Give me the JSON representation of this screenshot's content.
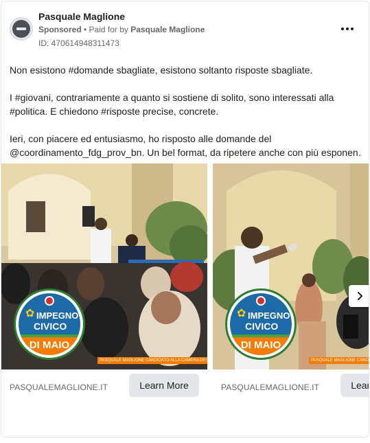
{
  "header": {
    "page_name": "Pasquale Maglione",
    "sponsored": "Sponsored",
    "separator": " • ",
    "paid_for_by": "Paid for by",
    "payer": "Pasquale Maglione",
    "ad_id": "ID: 470614948311473"
  },
  "body": {
    "paragraph_1": "Non esistono #domande sbagliate, esistono soltanto risposte sbagliate.",
    "paragraph_2": "I #giovani, contrariamente a quanto si sostiene di solito, sono interessati alla #politica. E chiedono #risposte precise, concrete.",
    "paragraph_3_line_1": "Ieri, con piacere ed entusiasmo, ho risposto alle domande del",
    "paragraph_3_line_2": "@coordinamento_fdg_prov_bn. Un bel format, da ripetere anche con più esponen…"
  },
  "cards": [
    {
      "domain": "PASQUALEMAGLIONE.IT",
      "cta": "Learn More",
      "badge_line_1": "IMPEGNO",
      "badge_line_2": "CIVICO",
      "badge_line_3": "DI MAIO",
      "caption": "PASQUALE MAGLIONE CANDIDATO ALLA CAMERA DEI DEPUTATI"
    },
    {
      "domain": "PASQUALEMAGLIONE.IT",
      "cta": "Learn More",
      "badge_line_1": "IMPEGNO",
      "badge_line_2": "CIVICO",
      "badge_line_3": "DI MAIO",
      "caption": "PASQUALE MAGLIONE CANDIDATO ALLA CAMERA DEI DEPUTATI"
    }
  ],
  "icons": {
    "more": "more-horizontal-icon",
    "next": "chevron-right-icon",
    "avatar": "blocked-avatar-icon"
  },
  "colors": {
    "text_primary": "#1c1e21",
    "text_secondary": "#65676b",
    "button_bg": "#e4e6eb",
    "badge_blue": "#1d6aa8",
    "badge_orange": "#f57c00"
  }
}
